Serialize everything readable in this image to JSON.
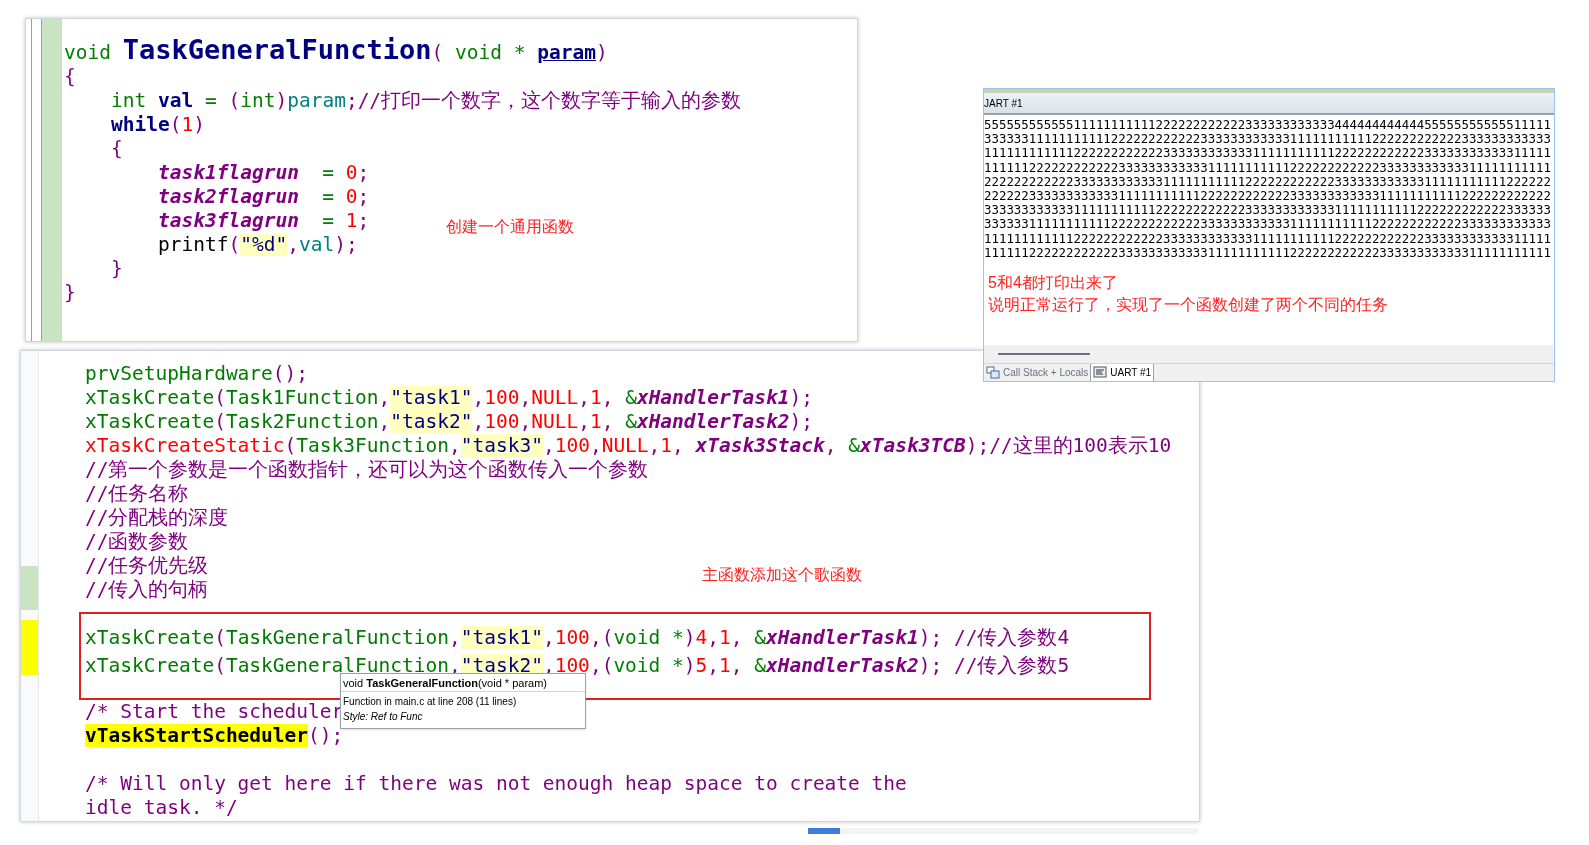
{
  "function_panel": {
    "lines": [
      [
        {
          "text": "void ",
          "kind": "kw"
        },
        {
          "text": "TaskGeneralFunction",
          "kind": "title"
        },
        {
          "text": "(",
          "kind": "punct"
        },
        {
          "text": " void * ",
          "kind": "kw"
        },
        {
          "text": "param",
          "kind": "param"
        },
        {
          "text": ")",
          "kind": "punct"
        }
      ],
      [
        {
          "text": "{",
          "kind": "punct"
        }
      ],
      [
        {
          "text": "    int",
          "kind": "kw"
        },
        {
          "text": " val",
          "kind": "ident"
        },
        {
          "text": " = ",
          "kind": "kw"
        },
        {
          "text": "(",
          "kind": "punct"
        },
        {
          "text": "int",
          "kind": "kw"
        },
        {
          "text": ")",
          "kind": "punct"
        },
        {
          "text": "param",
          "kind": "var"
        },
        {
          "text": ";",
          "kind": "punct"
        },
        {
          "text": "//打印一个数字，这个数字等于输入的参数",
          "kind": "comment"
        }
      ],
      [
        {
          "text": "    while",
          "kind": "ctrl"
        },
        {
          "text": "(",
          "kind": "punct"
        },
        {
          "text": "1",
          "kind": "num"
        },
        {
          "text": ")",
          "kind": "punct"
        }
      ],
      [
        {
          "text": "    {",
          "kind": "punct"
        }
      ],
      [
        {
          "text": "        task1flagrun",
          "kind": "ref"
        },
        {
          "text": "  = ",
          "kind": "kw"
        },
        {
          "text": "0",
          "kind": "num"
        },
        {
          "text": ";",
          "kind": "punct"
        }
      ],
      [
        {
          "text": "        task2flagrun",
          "kind": "ref"
        },
        {
          "text": "  = ",
          "kind": "kw"
        },
        {
          "text": "0",
          "kind": "num"
        },
        {
          "text": ";",
          "kind": "punct"
        }
      ],
      [
        {
          "text": "        task3flagrun",
          "kind": "ref"
        },
        {
          "text": "  = ",
          "kind": "kw"
        },
        {
          "text": "1",
          "kind": "num"
        },
        {
          "text": ";",
          "kind": "punct"
        }
      ],
      [
        {
          "text": "        printf",
          "kind": "plain"
        },
        {
          "text": "(",
          "kind": "punct"
        },
        {
          "text": "\"%d\"",
          "kind": "string"
        },
        {
          "text": ",",
          "kind": "punct"
        },
        {
          "text": "val",
          "kind": "var"
        },
        {
          "text": ");",
          "kind": "punct"
        }
      ],
      [
        {
          "text": "    }",
          "kind": "punct"
        }
      ],
      [
        {
          "text": "}",
          "kind": "punct"
        }
      ]
    ],
    "note": "创建一个通用函数"
  },
  "uart_panel": {
    "title": "JART #1",
    "output": [
      "5555555555551111111111122222222222233333333333344444444444455555555555511111",
      "3333331111111111122222222222233333333333311111111111222222222222333333333333",
      "1111111111112222222222223333333333331111111111122222222222233333333333311111",
      "1111112222222222223333333333331111111111122222222222233333333333311111111111",
      "2222222222223333333333331111111111122222222222233333333333311111111111222222",
      "2222223333333333331111111111122222222222233333333333311111111111222222222222",
      "3333333333331111111111122222222222233333333333311111111111222222222222333333",
      "3333331111111111122222222222233333333333311111111111222222222222333333333333",
      "1111111111112222222222223333333333331111111111122222222222233333333333311111",
      "1111112222222222223333333333331111111111122222222222233333333333311111111111"
    ],
    "notes": [
      "5和4都打印出来了",
      "说明正常运行了，实现了一个函数创建了两个不同的任务"
    ],
    "tabs": [
      {
        "label": "Call Stack + Locals",
        "selected": false
      },
      {
        "label": "UART #1",
        "selected": true
      }
    ]
  },
  "main_panel": {
    "sections": [
      {
        "boxed": false,
        "lines": [
          [
            {
              "text": "prvSetupHardware",
              "kind": "fn"
            },
            {
              "text": "();",
              "kind": "punct"
            }
          ],
          [
            {
              "text": "xTaskCreate",
              "kind": "fn"
            },
            {
              "text": "(",
              "kind": "punct"
            },
            {
              "text": "Task1Function",
              "kind": "fn"
            },
            {
              "text": ",",
              "kind": "punct"
            },
            {
              "text": "\"task1\"",
              "kind": "string"
            },
            {
              "text": ",",
              "kind": "punct"
            },
            {
              "text": "100",
              "kind": "num"
            },
            {
              "text": ",",
              "kind": "punct"
            },
            {
              "text": "NULL",
              "kind": "num"
            },
            {
              "text": ",",
              "kind": "punct"
            },
            {
              "text": "1",
              "kind": "num"
            },
            {
              "text": ", ",
              "kind": "punct"
            },
            {
              "text": "&",
              "kind": "kw"
            },
            {
              "text": "xHandlerTask1",
              "kind": "ref"
            },
            {
              "text": ");",
              "kind": "punct"
            }
          ],
          [
            {
              "text": "xTaskCreate",
              "kind": "fn"
            },
            {
              "text": "(",
              "kind": "punct"
            },
            {
              "text": "Task2Function",
              "kind": "fn"
            },
            {
              "text": ",",
              "kind": "punct"
            },
            {
              "text": "\"task2\"",
              "kind": "string"
            },
            {
              "text": ",",
              "kind": "punct"
            },
            {
              "text": "100",
              "kind": "num"
            },
            {
              "text": ",",
              "kind": "punct"
            },
            {
              "text": "NULL",
              "kind": "num"
            },
            {
              "text": ",",
              "kind": "punct"
            },
            {
              "text": "1",
              "kind": "num"
            },
            {
              "text": ", ",
              "kind": "punct"
            },
            {
              "text": "&",
              "kind": "kw"
            },
            {
              "text": "xHandlerTask2",
              "kind": "ref"
            },
            {
              "text": ");",
              "kind": "punct"
            }
          ],
          [
            {
              "text": "xTaskCreateStatic",
              "kind": "red"
            },
            {
              "text": "(",
              "kind": "punct"
            },
            {
              "text": "Task3Function",
              "kind": "fn"
            },
            {
              "text": ",",
              "kind": "punct"
            },
            {
              "text": "\"task3\"",
              "kind": "string"
            },
            {
              "text": ",",
              "kind": "punct"
            },
            {
              "text": "100",
              "kind": "num"
            },
            {
              "text": ",",
              "kind": "punct"
            },
            {
              "text": "NULL",
              "kind": "num"
            },
            {
              "text": ",",
              "kind": "punct"
            },
            {
              "text": "1",
              "kind": "num"
            },
            {
              "text": ", ",
              "kind": "punct"
            },
            {
              "text": "xTask3Stack",
              "kind": "ref"
            },
            {
              "text": ", ",
              "kind": "punct"
            },
            {
              "text": "&",
              "kind": "kw"
            },
            {
              "text": "xTask3TCB",
              "kind": "ref"
            },
            {
              "text": ");",
              "kind": "punct"
            },
            {
              "text": "//这里的100表示10",
              "kind": "comment"
            }
          ],
          [
            {
              "text": "//第一个参数是一个函数指针，还可以为这个函数传入一个参数",
              "kind": "comment"
            }
          ],
          [
            {
              "text": "//任务名称",
              "kind": "comment"
            }
          ],
          [
            {
              "text": "//分配栈的深度",
              "kind": "comment"
            }
          ],
          [
            {
              "text": "//函数参数",
              "kind": "comment"
            }
          ],
          [
            {
              "text": "//任务优先级",
              "kind": "comment"
            }
          ],
          [
            {
              "text": "//传入的句柄",
              "kind": "comment"
            }
          ]
        ]
      },
      {
        "boxed": true,
        "lines": [
          [
            {
              "text": "xTaskCreate",
              "kind": "fn"
            },
            {
              "text": "(",
              "kind": "punct"
            },
            {
              "text": "TaskGeneralFunction",
              "kind": "fn"
            },
            {
              "text": ",",
              "kind": "punct"
            },
            {
              "text": "\"task1\"",
              "kind": "string"
            },
            {
              "text": ",",
              "kind": "punct"
            },
            {
              "text": "100",
              "kind": "num"
            },
            {
              "text": ",",
              "kind": "punct"
            },
            {
              "text": "(",
              "kind": "punct"
            },
            {
              "text": "void *",
              "kind": "kw"
            },
            {
              "text": ")",
              "kind": "punct"
            },
            {
              "text": "4",
              "kind": "num"
            },
            {
              "text": ",",
              "kind": "punct"
            },
            {
              "text": "1",
              "kind": "num"
            },
            {
              "text": ", ",
              "kind": "punct"
            },
            {
              "text": "&",
              "kind": "kw"
            },
            {
              "text": "xHandlerTask1",
              "kind": "ref"
            },
            {
              "text": "); ",
              "kind": "punct"
            },
            {
              "text": "//传入参数4",
              "kind": "comment"
            }
          ],
          [
            {
              "text": "xTaskCreate",
              "kind": "fn"
            },
            {
              "text": "(",
              "kind": "punct"
            },
            {
              "text": "TaskGeneralFunction",
              "kind": "fn"
            },
            {
              "text": ",",
              "kind": "punct"
            },
            {
              "text": "\"task2\"",
              "kind": "string"
            },
            {
              "text": ",",
              "kind": "punct"
            },
            {
              "text": "100",
              "kind": "num"
            },
            {
              "text": ",",
              "kind": "punct"
            },
            {
              "text": "(",
              "kind": "punct"
            },
            {
              "text": "void *",
              "kind": "kw"
            },
            {
              "text": ")",
              "kind": "punct"
            },
            {
              "text": "5",
              "kind": "num"
            },
            {
              "text": ",",
              "kind": "punct"
            },
            {
              "text": "1",
              "kind": "num"
            },
            {
              "text": ", ",
              "kind": "punct"
            },
            {
              "text": "&",
              "kind": "kw"
            },
            {
              "text": "xHandlerTask2",
              "kind": "ref"
            },
            {
              "text": "); ",
              "kind": "punct"
            },
            {
              "text": "//传入参数5",
              "kind": "comment"
            }
          ]
        ]
      },
      {
        "boxed": false,
        "lines": [
          [
            {
              "text": "/* Start the scheduler",
              "kind": "comment"
            }
          ],
          [
            {
              "text": "vTaskStartScheduler",
              "kind": "hl"
            },
            {
              "text": "();",
              "kind": "punct"
            }
          ]
        ]
      },
      {
        "boxed": false,
        "lines": [
          [
            {
              "text": "/* Will only get here if there was not enough heap space to create the",
              "kind": "comment"
            }
          ],
          [
            {
              "text": "idle task. */",
              "kind": "comment"
            }
          ]
        ]
      }
    ],
    "note": "主函数添加这个歌函数"
  },
  "tooltip": {
    "signature": "void **TaskGeneralFunction**(void * param)",
    "location": "Function in main.c at line 208 (11 lines)",
    "style": "Style: Ref to Func"
  }
}
